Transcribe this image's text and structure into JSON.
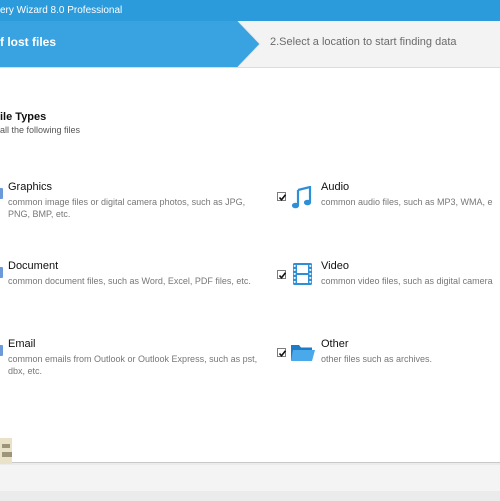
{
  "window": {
    "title": "ery Wizard 8.0 Professional"
  },
  "steps": {
    "step1": "f lost files",
    "step2": "2.Select a location to start finding data"
  },
  "section": {
    "title": "ile Types",
    "subtitle": "all the following files"
  },
  "file_types": [
    {
      "name": "Graphics",
      "desc": "common image files or digital camera photos, such as JPG, PNG, BMP, etc.",
      "checked": true,
      "icon": "graphics-icon"
    },
    {
      "name": "Audio",
      "desc": "common audio files, such as MP3, WMA, e",
      "checked": true,
      "icon": "music-note-icon"
    },
    {
      "name": "Document",
      "desc": "common document files, such as Word, Excel, PDF files, etc.",
      "checked": true,
      "icon": "document-icon"
    },
    {
      "name": "Video",
      "desc": "common video files, such as digital camera",
      "checked": true,
      "icon": "film-icon"
    },
    {
      "name": "Email",
      "desc": "common emails from Outlook or Outlook Express, such as pst, dbx, etc.",
      "checked": true,
      "icon": "email-icon"
    },
    {
      "name": "Other",
      "desc": "other files such as archives.",
      "checked": true,
      "icon": "folder-icon"
    }
  ],
  "colors": {
    "title_bar": "#2b9bdc",
    "active_step": "#39a3e2",
    "accent_icon": "#2e8fd6"
  }
}
